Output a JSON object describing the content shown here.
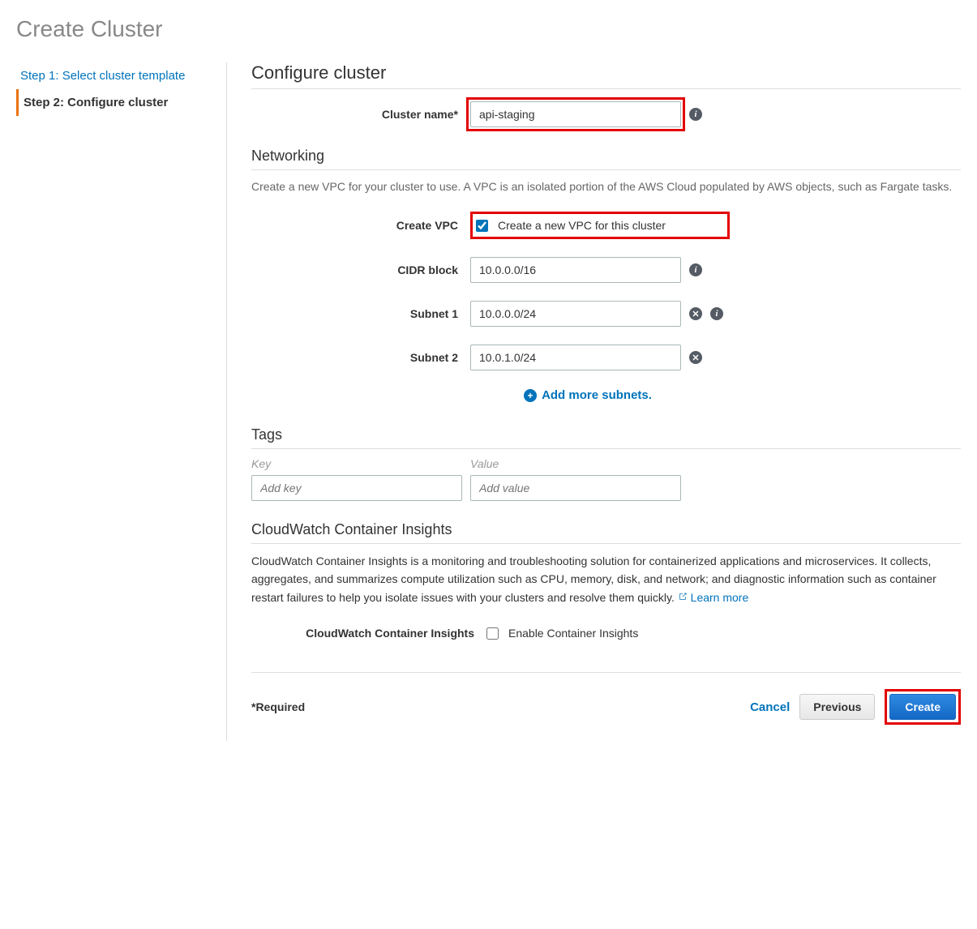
{
  "page_title": "Create Cluster",
  "sidebar": {
    "step1_label": "Step 1: Select cluster template",
    "step2_label": "Step 2: Configure cluster"
  },
  "configure": {
    "heading": "Configure cluster",
    "cluster_name_label": "Cluster name*",
    "cluster_name_value": "api-staging"
  },
  "networking": {
    "heading": "Networking",
    "description": "Create a new VPC for your cluster to use. A VPC is an isolated portion of the AWS Cloud populated by AWS objects, such as Fargate tasks.",
    "create_vpc_label": "Create VPC",
    "create_vpc_text": "Create a new VPC for this cluster",
    "cidr_label": "CIDR block",
    "cidr_value": "10.0.0.0/16",
    "subnet1_label": "Subnet 1",
    "subnet1_value": "10.0.0.0/24",
    "subnet2_label": "Subnet 2",
    "subnet2_value": "10.0.1.0/24",
    "add_more_label": "Add more subnets."
  },
  "tags": {
    "heading": "Tags",
    "key_header": "Key",
    "value_header": "Value",
    "key_placeholder": "Add key",
    "value_placeholder": "Add value"
  },
  "insights": {
    "heading": "CloudWatch Container Insights",
    "description": "CloudWatch Container Insights is a monitoring and troubleshooting solution for containerized applications and microservices. It collects, aggregates, and summarizes compute utilization such as CPU, memory, disk, and network; and diagnostic information such as container restart failures to help you isolate issues with your clusters and resolve them quickly.",
    "learn_more": "Learn more",
    "checkbox_section_label": "CloudWatch Container Insights",
    "checkbox_label": "Enable Container Insights"
  },
  "footer": {
    "required": "*Required",
    "cancel": "Cancel",
    "previous": "Previous",
    "create": "Create"
  }
}
